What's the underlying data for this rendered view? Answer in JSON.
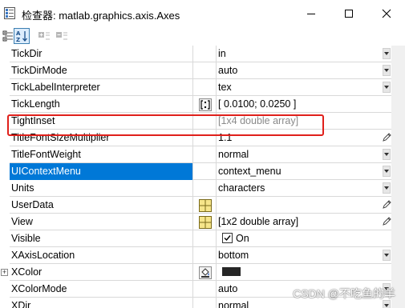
{
  "window": {
    "title": "检查器:  matlab.graphics.axis.Axes"
  },
  "properties": [
    {
      "name": "TickDir",
      "value": "in",
      "control": "dropdown"
    },
    {
      "name": "TickDirMode",
      "value": "auto",
      "control": "dropdown"
    },
    {
      "name": "TickLabelInterpreter",
      "value": "tex",
      "control": "dropdown"
    },
    {
      "name": "TickLength",
      "value": "[ 0.0100; 0.0250 ]",
      "control": "matrix-editor"
    },
    {
      "name": "TightInset",
      "value": "[1x4  double array]",
      "control": "none",
      "dim": true
    },
    {
      "name": "TitleFontSizeMultiplier",
      "value": "1.1",
      "control": "pencil"
    },
    {
      "name": "TitleFontWeight",
      "value": "normal",
      "control": "dropdown"
    },
    {
      "name": "UIContextMenu",
      "value": "context_menu",
      "control": "dropdown",
      "selected": true
    },
    {
      "name": "Units",
      "value": "characters",
      "control": "dropdown"
    },
    {
      "name": "UserData",
      "value": "",
      "control": "grid-editor-pencil"
    },
    {
      "name": "View",
      "value": "[1x2  double array]",
      "control": "grid-editor-pencil"
    },
    {
      "name": "Visible",
      "value": "On",
      "control": "checkbox",
      "checked": true
    },
    {
      "name": "XAxisLocation",
      "value": "bottom",
      "control": "dropdown"
    },
    {
      "name": "XColor",
      "value": "",
      "control": "color",
      "color": "#262626",
      "expandable": true
    },
    {
      "name": "XColorMode",
      "value": "auto",
      "control": "dropdown"
    },
    {
      "name": "XDir",
      "value": "normal",
      "control": "dropdown"
    }
  ],
  "watermark": "CSDN @不吃鱼的羊",
  "colors": {
    "selection": "#0078d7",
    "highlight_border": "#e0201b"
  }
}
